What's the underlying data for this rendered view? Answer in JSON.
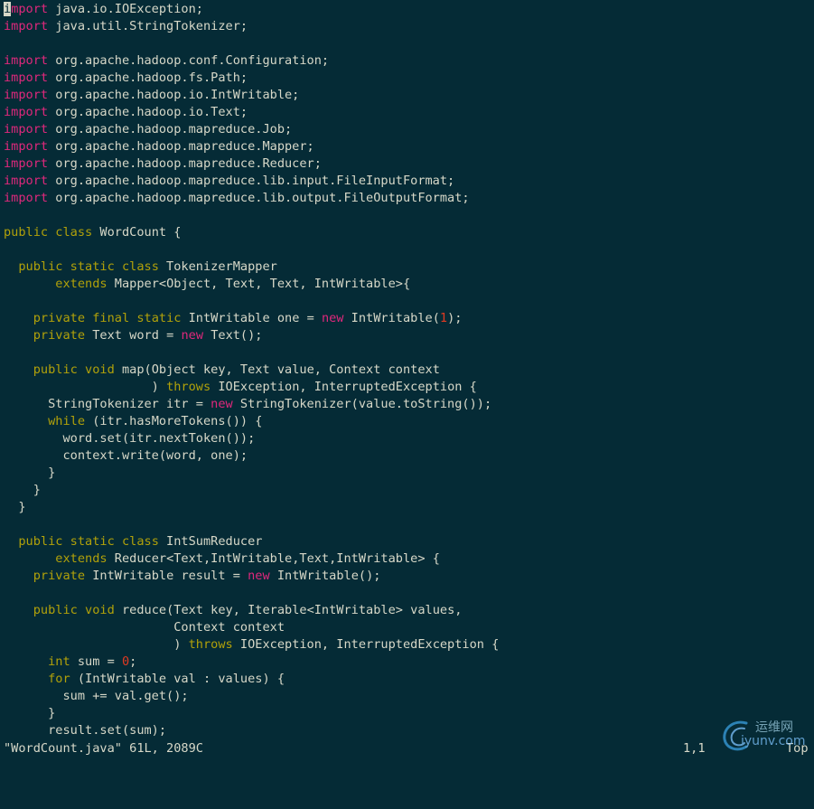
{
  "editor": {
    "lines": [
      [
        [
          "k",
          "i"
        ],
        [
          "k",
          "mport"
        ],
        [
          "t",
          " java.io.IOException;"
        ]
      ],
      [
        [
          "k",
          "import"
        ],
        [
          "t",
          " java.util.StringTokenizer;"
        ]
      ],
      [],
      [
        [
          "k",
          "import"
        ],
        [
          "t",
          " org.apache.hadoop.conf.Configuration;"
        ]
      ],
      [
        [
          "k",
          "import"
        ],
        [
          "t",
          " org.apache.hadoop.fs.Path;"
        ]
      ],
      [
        [
          "k",
          "import"
        ],
        [
          "t",
          " org.apache.hadoop.io.IntWritable;"
        ]
      ],
      [
        [
          "k",
          "import"
        ],
        [
          "t",
          " org.apache.hadoop.io.Text;"
        ]
      ],
      [
        [
          "k",
          "import"
        ],
        [
          "t",
          " org.apache.hadoop.mapreduce.Job;"
        ]
      ],
      [
        [
          "k",
          "import"
        ],
        [
          "t",
          " org.apache.hadoop.mapreduce.Mapper;"
        ]
      ],
      [
        [
          "k",
          "import"
        ],
        [
          "t",
          " org.apache.hadoop.mapreduce.Reducer;"
        ]
      ],
      [
        [
          "k",
          "import"
        ],
        [
          "t",
          " org.apache.hadoop.mapreduce.lib.input.FileInputFormat;"
        ]
      ],
      [
        [
          "k",
          "import"
        ],
        [
          "t",
          " org.apache.hadoop.mapreduce.lib.output.FileOutputFormat;"
        ]
      ],
      [],
      [
        [
          "y",
          "public class"
        ],
        [
          "t",
          " WordCount {"
        ]
      ],
      [],
      [
        [
          "t",
          "  "
        ],
        [
          "y",
          "public static class"
        ],
        [
          "t",
          " TokenizerMapper"
        ]
      ],
      [
        [
          "t",
          "       "
        ],
        [
          "y",
          "extends"
        ],
        [
          "t",
          " Mapper<Object, Text, Text, IntWritable>{"
        ]
      ],
      [],
      [
        [
          "t",
          "    "
        ],
        [
          "y",
          "private final static"
        ],
        [
          "t",
          " IntWritable one = "
        ],
        [
          "k",
          "new"
        ],
        [
          "t",
          " IntWritable("
        ],
        [
          "n",
          "1"
        ],
        [
          "t",
          ");"
        ]
      ],
      [
        [
          "t",
          "    "
        ],
        [
          "y",
          "private"
        ],
        [
          "t",
          " Text word = "
        ],
        [
          "k",
          "new"
        ],
        [
          "t",
          " Text();"
        ]
      ],
      [],
      [
        [
          "t",
          "    "
        ],
        [
          "y",
          "public void"
        ],
        [
          "t",
          " map(Object key, Text value, Context context"
        ]
      ],
      [
        [
          "t",
          "                    ) "
        ],
        [
          "y",
          "throws"
        ],
        [
          "t",
          " IOException, InterruptedException {"
        ]
      ],
      [
        [
          "t",
          "      StringTokenizer itr = "
        ],
        [
          "k",
          "new"
        ],
        [
          "t",
          " StringTokenizer(value.toString());"
        ]
      ],
      [
        [
          "t",
          "      "
        ],
        [
          "y",
          "while"
        ],
        [
          "t",
          " (itr.hasMoreTokens()) {"
        ]
      ],
      [
        [
          "t",
          "        word.set(itr.nextToken());"
        ]
      ],
      [
        [
          "t",
          "        context.write(word, one);"
        ]
      ],
      [
        [
          "t",
          "      }"
        ]
      ],
      [
        [
          "t",
          "    }"
        ]
      ],
      [
        [
          "t",
          "  }"
        ]
      ],
      [],
      [
        [
          "t",
          "  "
        ],
        [
          "y",
          "public static class"
        ],
        [
          "t",
          " IntSumReducer"
        ]
      ],
      [
        [
          "t",
          "       "
        ],
        [
          "y",
          "extends"
        ],
        [
          "t",
          " Reducer<Text,IntWritable,Text,IntWritable> {"
        ]
      ],
      [
        [
          "t",
          "    "
        ],
        [
          "y",
          "private"
        ],
        [
          "t",
          " IntWritable result = "
        ],
        [
          "k",
          "new"
        ],
        [
          "t",
          " IntWritable();"
        ]
      ],
      [],
      [
        [
          "t",
          "    "
        ],
        [
          "y",
          "public void"
        ],
        [
          "t",
          " reduce(Text key, Iterable<IntWritable> values,"
        ]
      ],
      [
        [
          "t",
          "                       Context context"
        ]
      ],
      [
        [
          "t",
          "                       ) "
        ],
        [
          "y",
          "throws"
        ],
        [
          "t",
          " IOException, InterruptedException {"
        ]
      ],
      [
        [
          "t",
          "      "
        ],
        [
          "y",
          "int"
        ],
        [
          "t",
          " sum = "
        ],
        [
          "n",
          "0"
        ],
        [
          "t",
          ";"
        ]
      ],
      [
        [
          "t",
          "      "
        ],
        [
          "y",
          "for"
        ],
        [
          "t",
          " (IntWritable val : values) {"
        ]
      ],
      [
        [
          "t",
          "        sum += val.get();"
        ]
      ],
      [
        [
          "t",
          "      }"
        ]
      ],
      [
        [
          "t",
          "      result.set(sum);"
        ]
      ]
    ]
  },
  "status": {
    "file": "\"WordCount.java\" 61L, 2089C",
    "position": "1,1",
    "scroll": "Top"
  },
  "watermark": {
    "cn": "运维网",
    "en": "iyunv.com"
  },
  "colors": {
    "background": "#052b36",
    "text": "#d7d8c8",
    "import_new": "#e0287c",
    "keyword": "#b1a10a",
    "number": "#e03a22"
  }
}
